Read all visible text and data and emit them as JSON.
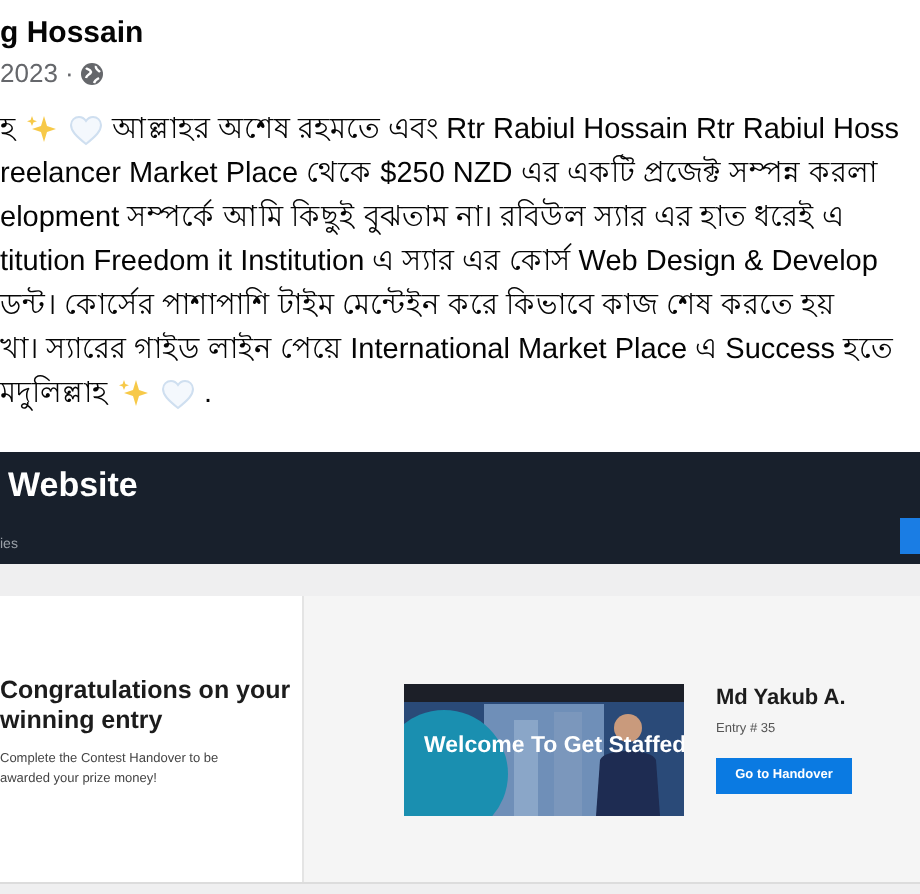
{
  "post": {
    "author": "g Hossain",
    "date": "2023 ·",
    "lines": [
      [
        {
          "kind": "text",
          "text": "হ"
        },
        {
          "kind": "sparkles"
        },
        {
          "kind": "heart"
        },
        {
          "kind": "text",
          "text": "আল্লাহর অশেষ রহমতে এবং Rtr Rabiul Hossain Rtr Rabiul Hoss"
        }
      ],
      [
        {
          "kind": "text",
          "text": "reelancer Market Place থেকে $250 NZD এর একটি প্রজেক্ট সম্পন্ন করলা"
        }
      ],
      [
        {
          "kind": "text",
          "text": "elopment সম্পর্কে আমি কিছুই বুঝতাম না। রবিউল স্যার এর হাত ধরেই এ"
        }
      ],
      [
        {
          "kind": "text",
          "text": "titution Freedom it Institution এ স্যার এর কোর্স Web Design & Develop"
        }
      ],
      [
        {
          "kind": "text",
          "text": "ডন্ট। কোর্সের পাশাপাশি টাইম মেন্টেইন করে কিভাবে কাজ শেষ করতে হয়"
        }
      ],
      [
        {
          "kind": "text",
          "text": "খা। স্যারের গাইড লাইন পেয়ে International Market Place এ Success হতে"
        }
      ],
      [
        {
          "kind": "text",
          "text": "মদুলিল্লাহ"
        },
        {
          "kind": "sparkles"
        },
        {
          "kind": "heart"
        },
        {
          "kind": "text",
          "text": "."
        }
      ]
    ]
  },
  "shot": {
    "title": "Website",
    "subtitle": "ies",
    "congrats": {
      "title": "Congratulations on your winning entry",
      "body": "Complete the Contest Handover to be awarded your prize money!"
    },
    "entry": {
      "thumb_text": "Welcome To Get Staffed",
      "name": "Md Yakub A.",
      "number": "Entry # 35",
      "button": "Go to Handover"
    }
  }
}
